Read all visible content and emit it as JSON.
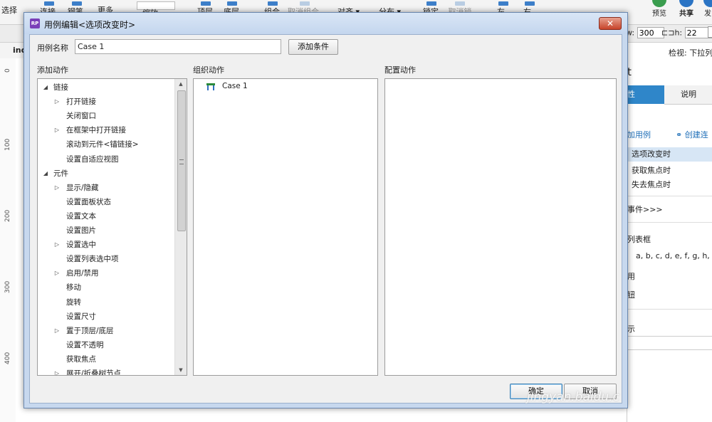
{
  "toolbar": {
    "items": [
      "选择",
      "连接",
      "钢笔",
      "更多 ▾",
      "缩放",
      "顶层",
      "底层",
      "组合",
      "取消组合",
      "对齐 ▾",
      "分布 ▾",
      "锁定",
      "取消锁定",
      "左",
      "右"
    ],
    "preview_label": "预览",
    "share_label": "共享",
    "publish_label": "发"
  },
  "dimensions": {
    "w_label": "w:",
    "w_value": "300",
    "h_label": "h:",
    "h_value": "22"
  },
  "page_tab": "ind",
  "ruler": [
    "0",
    "100",
    "200",
    "300",
    "400"
  ],
  "right_panel": {
    "inspect_label": "检视: 下拉列表",
    "header": "t",
    "tab_properties": "性",
    "tab_notes": "说明",
    "add_case_link": "加用例",
    "create_link": "创建连",
    "events": [
      "选项改变时",
      "获取焦点时",
      "失去焦点时"
    ],
    "more_events": "事件>>>",
    "list_box_label": "列表框",
    "list_values": "a, b, c, d, e, f, g, h, i, j,",
    "item1": "用",
    "item2": "钮",
    "item3": "示"
  },
  "dialog": {
    "title": "用例编辑<选项改变时>",
    "case_name_label": "用例名称",
    "case_name_value": "Case 1",
    "add_condition_button": "添加条件",
    "add_action_header": "添加动作",
    "organize_action_header": "组织动作",
    "configure_action_header": "配置动作",
    "tree": [
      {
        "label": "链接",
        "level": 0,
        "arrow": "◢"
      },
      {
        "label": "打开链接",
        "level": 1,
        "arrow": "▷"
      },
      {
        "label": "关闭窗口",
        "level": 1,
        "arrow": ""
      },
      {
        "label": "在框架中打开链接",
        "level": 1,
        "arrow": "▷"
      },
      {
        "label": "滚动到元件<锚链接>",
        "level": 1,
        "arrow": ""
      },
      {
        "label": "设置自适应视图",
        "level": 1,
        "arrow": ""
      },
      {
        "label": "元件",
        "level": 0,
        "arrow": "◢"
      },
      {
        "label": "显示/隐藏",
        "level": 1,
        "arrow": "▷"
      },
      {
        "label": "设置面板状态",
        "level": 1,
        "arrow": ""
      },
      {
        "label": "设置文本",
        "level": 1,
        "arrow": ""
      },
      {
        "label": "设置图片",
        "level": 1,
        "arrow": ""
      },
      {
        "label": "设置选中",
        "level": 1,
        "arrow": "▷"
      },
      {
        "label": "设置列表选中项",
        "level": 1,
        "arrow": ""
      },
      {
        "label": "启用/禁用",
        "level": 1,
        "arrow": "▷"
      },
      {
        "label": "移动",
        "level": 1,
        "arrow": ""
      },
      {
        "label": "旋转",
        "level": 1,
        "arrow": ""
      },
      {
        "label": "设置尺寸",
        "level": 1,
        "arrow": ""
      },
      {
        "label": "置于顶层/底层",
        "level": 1,
        "arrow": "▷"
      },
      {
        "label": "设置不透明",
        "level": 1,
        "arrow": ""
      },
      {
        "label": "获取焦点",
        "level": 1,
        "arrow": ""
      },
      {
        "label": "展开/折叠树节点",
        "level": 1,
        "arrow": "▷"
      }
    ],
    "organized_case": "Case 1",
    "ok_button": "确定",
    "cancel_button": "取消",
    "close_glyph": "✕"
  },
  "watermark": "jingyan.baidu.c"
}
